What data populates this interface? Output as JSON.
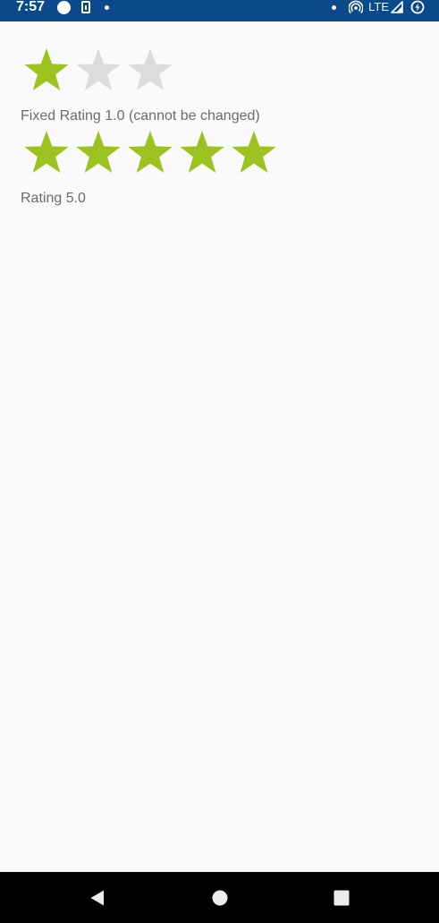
{
  "status_bar": {
    "time": "7:57",
    "network": "LTE",
    "background": "#0a4a8a"
  },
  "colors": {
    "star_filled": "#9cc320",
    "star_empty": "#dcdcdc",
    "label_text": "#6b6b6b"
  },
  "rating_bars": [
    {
      "value": 1.0,
      "max": 3,
      "label": "Fixed Rating 1.0 (cannot be changed)",
      "editable": false
    },
    {
      "value": 5.0,
      "max": 5,
      "label": "Rating 5.0",
      "editable": true
    }
  ],
  "nav_bar": {
    "icons": [
      "back-icon",
      "home-icon",
      "recents-icon"
    ]
  }
}
